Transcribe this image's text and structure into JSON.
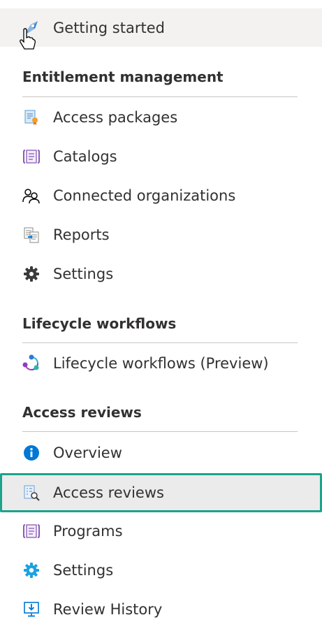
{
  "top": {
    "getting_started": "Getting started"
  },
  "entitlement": {
    "heading": "Entitlement management",
    "items": [
      "Access packages",
      "Catalogs",
      "Connected organizations",
      "Reports",
      "Settings"
    ]
  },
  "lifecycle": {
    "heading": "Lifecycle workflows",
    "items": [
      "Lifecycle workflows (Preview)"
    ]
  },
  "reviews": {
    "heading": "Access reviews",
    "items": [
      "Overview",
      "Access reviews",
      "Programs",
      "Settings",
      "Review History"
    ]
  },
  "icons": {
    "getting_started": "rocket-icon",
    "access_packages": "access-package-icon",
    "catalogs": "catalog-icon",
    "connected_orgs": "people-icon",
    "reports": "reports-icon",
    "settings": "gear-icon",
    "lifecycle": "lifecycle-icon",
    "overview": "info-icon",
    "access_reviews": "access-review-icon",
    "programs": "programs-icon",
    "settings_blue": "gear-blue-icon",
    "review_history": "download-monitor-icon"
  },
  "colors": {
    "selected_border": "#1ba38c",
    "selected_bg": "#ebebeb",
    "hover_bg": "#f3f2f1",
    "info_blue": "#0078d4"
  }
}
